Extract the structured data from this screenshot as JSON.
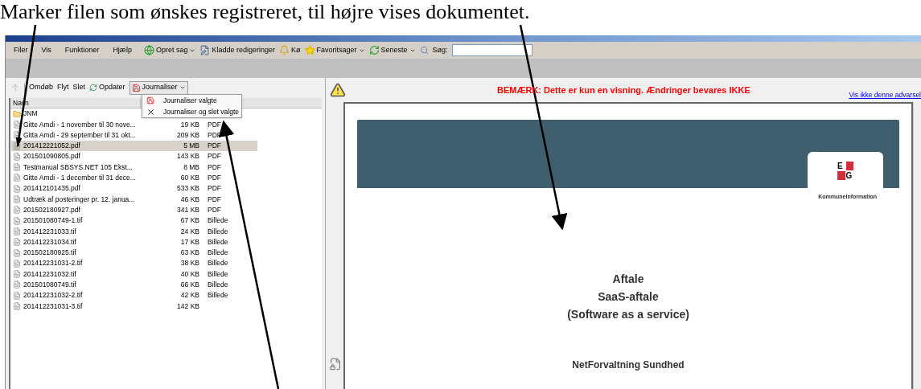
{
  "caption": "Marker filen som ønskes registreret, til højre vises dokumentet.",
  "menu_bar": [
    "Filer",
    "Vis",
    "Funktioner",
    "Hjælp"
  ],
  "main_toolbar": [
    {
      "label": "Opret sag",
      "kind": "globe",
      "dropdown": true
    },
    {
      "label": "Kladde redigeringer",
      "kind": "edit",
      "dropdown": false
    },
    {
      "label": "Kø",
      "kind": "bell",
      "dropdown": false
    },
    {
      "label": "Favoritsager",
      "kind": "star",
      "dropdown": true
    },
    {
      "label": "Seneste",
      "kind": "recent",
      "dropdown": true
    }
  ],
  "search": {
    "label": "Søg:"
  },
  "file_toolbar": {
    "buttons": [
      {
        "label": "Omdøb",
        "kind": "text"
      },
      {
        "label": "Flyt",
        "kind": "text"
      },
      {
        "label": "Slet",
        "kind": "text"
      },
      {
        "label": "Opdater",
        "kind": "refresh"
      }
    ],
    "journaliser": {
      "label": "Journaliser",
      "expanded": true
    }
  },
  "dropdown_menu": [
    {
      "label": "Journaliser valgte",
      "kind": "save"
    },
    {
      "label": "Journaliser og slet valgte",
      "kind": "delete"
    }
  ],
  "file_list": {
    "columns": [
      "Navn"
    ],
    "rows": [
      {
        "name": "JNM",
        "kind": "folder",
        "selected": false
      },
      {
        "name": "Gitte Amdi - 1 november til 30 nove...",
        "size": "19 KB",
        "type": "PDF",
        "kind": "file",
        "selected": false
      },
      {
        "name": "Gitta Amdi - 29 september til 31 okt...",
        "size": "209 KB",
        "type": "PDF",
        "kind": "file",
        "selected": false
      },
      {
        "name": "201412221052.pdf",
        "size": "5 MB",
        "type": "PDF",
        "kind": "file",
        "selected": true
      },
      {
        "name": "201501090805.pdf",
        "size": "143 KB",
        "type": "PDF",
        "kind": "file",
        "selected": false
      },
      {
        "name": "Testmanual SBSYS.NET 105 Ekst...",
        "size": "8 MB",
        "type": "PDF",
        "kind": "file",
        "selected": false
      },
      {
        "name": "Gitte Amdi - 1 december til 31 dece...",
        "size": "60 KB",
        "type": "PDF",
        "kind": "file",
        "selected": false
      },
      {
        "name": "201412101435.pdf",
        "size": "533 KB",
        "type": "PDF",
        "kind": "file",
        "selected": false
      },
      {
        "name": "Udtræk af posteringer pr. 12. janua...",
        "size": "46 KB",
        "type": "PDF",
        "kind": "file",
        "selected": false
      },
      {
        "name": "201502180927.pdf",
        "size": "341 KB",
        "type": "PDF",
        "kind": "file",
        "selected": false
      },
      {
        "name": "201501080749-1.tif",
        "size": "67 KB",
        "type": "Billede",
        "kind": "file",
        "selected": false
      },
      {
        "name": "201412231033.tif",
        "size": "24 KB",
        "type": "Billede",
        "kind": "file",
        "selected": false
      },
      {
        "name": "201412231034.tif",
        "size": "17 KB",
        "type": "Billede",
        "kind": "file",
        "selected": false
      },
      {
        "name": "201502180925.tif",
        "size": "63 KB",
        "type": "Billede",
        "kind": "file",
        "selected": false
      },
      {
        "name": "201412231031-2.tif",
        "size": "38 KB",
        "type": "Billede",
        "kind": "file",
        "selected": false
      },
      {
        "name": "201412231032.tif",
        "size": "40 KB",
        "type": "Billede",
        "kind": "file",
        "selected": false
      },
      {
        "name": "201501080749.tif",
        "size": "66 KB",
        "type": "Billede",
        "kind": "file",
        "selected": false
      },
      {
        "name": "201412231032-2.tif",
        "size": "42 KB",
        "type": "Billede",
        "kind": "file",
        "selected": false
      },
      {
        "name": "201412231031-3.tif",
        "size": "142 KB",
        "kind": "file",
        "selected": false
      }
    ]
  },
  "preview": {
    "warning": "BEMÆRK: Dette er kun en visning. Ændringer bevares IKKE",
    "hide_link": "Vis ikke denne advarsel",
    "logo_letters": [
      "E",
      "G"
    ],
    "logo_caption": "Kommuneinformation",
    "title_lines": [
      "Aftale",
      "SaaS-aftale",
      "(Software as a service)"
    ],
    "subtitle": "NetForvaltning Sundhed"
  }
}
